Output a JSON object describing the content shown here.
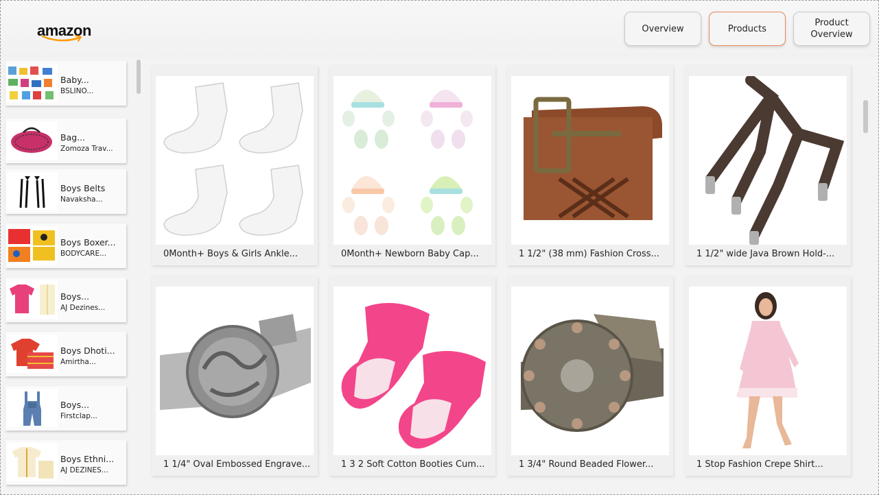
{
  "brand": {
    "logo_text": "amazon",
    "accent": "#ff9900"
  },
  "nav": {
    "buttons": [
      {
        "label": "Overview"
      },
      {
        "label": "Products",
        "active": true
      },
      {
        "label": "Product Overview"
      }
    ],
    "active_border": "#e08a5a"
  },
  "sidebar": {
    "items": [
      {
        "title": "Baby...",
        "subtitle": "BSLINO...",
        "icon": "baby-socks-thumbnail"
      },
      {
        "title": "Bag...",
        "subtitle": "Zomoza Trav...",
        "icon": "pink-bag-thumbnail"
      },
      {
        "title": "Boys Belts",
        "subtitle": "Navaksha...",
        "icon": "suspenders-thumbnail"
      },
      {
        "title": "Boys Boxer...",
        "subtitle": "BODYCARE...",
        "icon": "boxer-shorts-thumbnail"
      },
      {
        "title": "Boys...",
        "subtitle": "AJ Dezines...",
        "icon": "pink-shirt-thumbnail"
      },
      {
        "title": "Boys Dhoti...",
        "subtitle": "Amirtha...",
        "icon": "dhoti-thumbnail"
      },
      {
        "title": "Boys...",
        "subtitle": "Firstclap...",
        "icon": "denim-dungaree-thumbnail"
      },
      {
        "title": "Boys Ethni...",
        "subtitle": "AJ DEZINES...",
        "icon": "ethnic-wear-thumbnail"
      }
    ]
  },
  "products": [
    {
      "title": "0Month+ Boys & Girls Ankle...",
      "icon": "white-socks-image"
    },
    {
      "title": "0Month+ Newborn Baby Cap...",
      "icon": "baby-caps-mittens-image"
    },
    {
      "title": "1 1/2\" (38 mm) Fashion Cross...",
      "icon": "brown-belt-image"
    },
    {
      "title": "1 1/2\" wide Java Brown Hold-...",
      "icon": "brown-suspenders-image"
    },
    {
      "title": "1 1/4\" Oval Embossed Engrave...",
      "icon": "silver-buckle-belt-image"
    },
    {
      "title": "1 3 2 Soft Cotton Booties Cum...",
      "icon": "pink-booties-image"
    },
    {
      "title": "1 3/4\" Round Beaded Flower...",
      "icon": "beaded-buckle-belt-image"
    },
    {
      "title": "1 Stop Fashion Crepe Shirt...",
      "icon": "pink-shirt-dress-image"
    }
  ]
}
